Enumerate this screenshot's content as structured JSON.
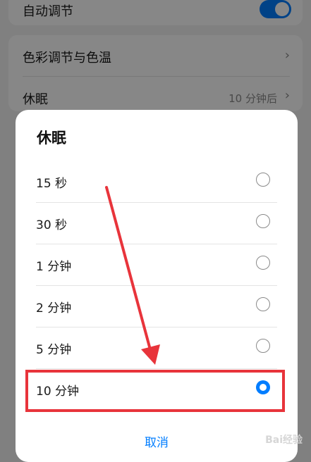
{
  "settings": {
    "auto_adjust_label": "自动调节",
    "auto_adjust_on": true,
    "color_temp_label": "色彩调节与色温",
    "sleep_label": "休眠",
    "sleep_value": "10 分钟后"
  },
  "dialog": {
    "title": "休眠",
    "options": [
      {
        "label": "15 秒",
        "selected": false
      },
      {
        "label": "30 秒",
        "selected": false
      },
      {
        "label": "1 分钟",
        "selected": false
      },
      {
        "label": "2 分钟",
        "selected": false
      },
      {
        "label": "5 分钟",
        "selected": false
      },
      {
        "label": "10 分钟",
        "selected": true
      }
    ],
    "cancel_label": "取消"
  },
  "colors": {
    "accent": "#007dff",
    "annotation": "#e8343b"
  },
  "watermark": "Bai经验"
}
